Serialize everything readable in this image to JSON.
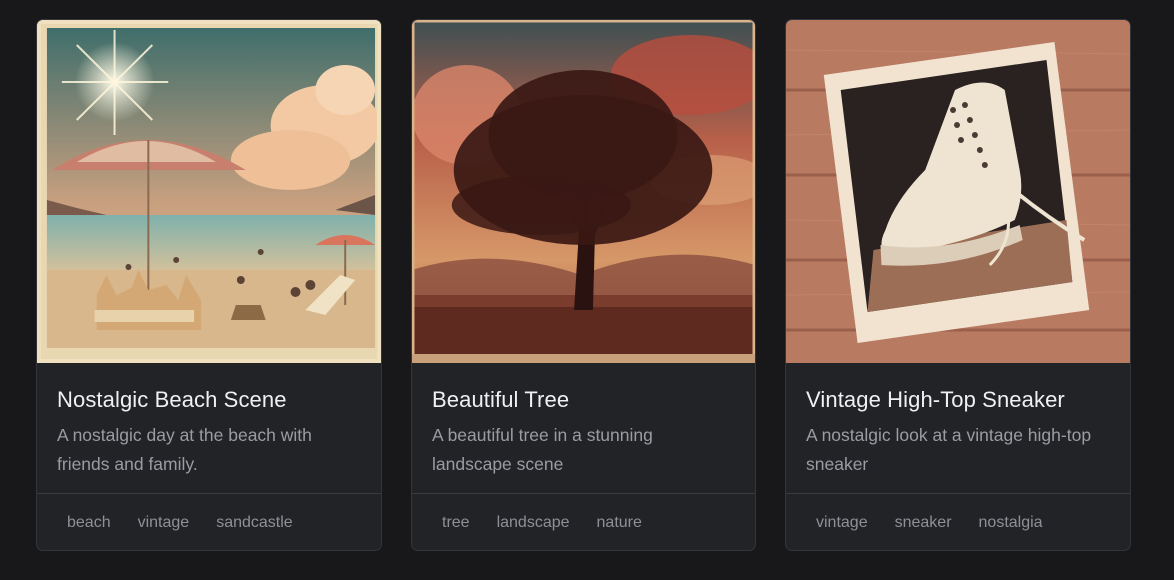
{
  "cards": [
    {
      "title": "Nostalgic Beach Scene",
      "description": "A nostalgic day at the beach with friends and family.",
      "tags": [
        "beach",
        "vintage",
        "sandcastle"
      ],
      "image": "vintage beach photo"
    },
    {
      "title": "Beautiful Tree",
      "description": "A beautiful tree in a stunning landscape scene",
      "tags": [
        "tree",
        "landscape",
        "nature"
      ],
      "image": "vintage tree landscape photo"
    },
    {
      "title": "Vintage High-Top Sneaker",
      "description": "A nostalgic look at a vintage high-top sneaker",
      "tags": [
        "vintage",
        "sneaker",
        "nostalgia"
      ],
      "image": "vintage sneaker polaroid photo"
    }
  ],
  "colors": {
    "page_background": "#18181b",
    "card_background": "#222326",
    "title_text": "#eef0f3",
    "muted_text": "#9a9ca3"
  }
}
